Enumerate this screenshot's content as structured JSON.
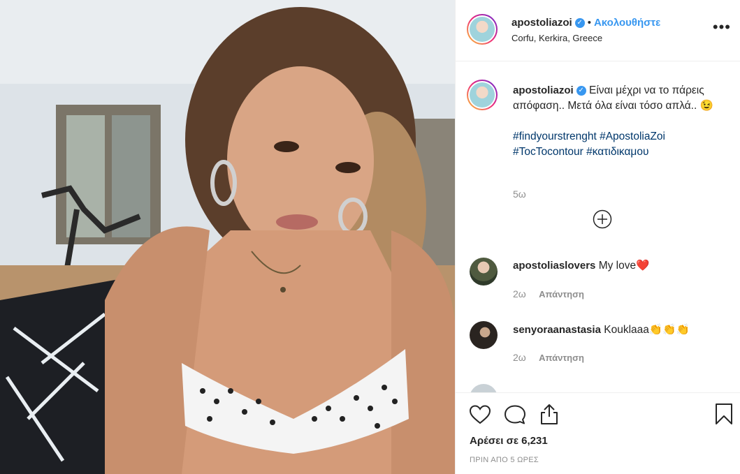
{
  "post": {
    "author": "apostoliazoi",
    "follow_label": "Ακολουθήστε",
    "separator": "•",
    "location": "Corfu, Kerkira, Greece"
  },
  "caption": {
    "username": "apostoliazoi",
    "text": "Είναι μέχρι να το πάρεις απόφαση.. Μετά όλα είναι τόσο απλά..",
    "emoji": "😉",
    "hashtags_line1": "#findyourstrenght #ApostoliaZoi",
    "hashtags_line2": "#TocTocontour #κατιδικαμου",
    "time": "5ω"
  },
  "comments": [
    {
      "username": "apostoliaslovers",
      "text": "My love",
      "emoji": "❤️",
      "time": "2ω",
      "reply_label": "Απάντηση"
    },
    {
      "username": "senyoraanastasia",
      "text": "Kouklaaa",
      "emoji": "👏👏👏",
      "time": "2ω",
      "reply_label": "Απάντηση"
    }
  ],
  "footer": {
    "likes_label": "Αρέσει σε 6,231",
    "timestamp": "ΠΡΙΝ ΑΠΟ 5 ΩΡΕΣ"
  },
  "icons": {
    "more": "more-options-icon",
    "load_more": "plus-circle-icon",
    "like": "heart-icon",
    "comment": "comment-icon",
    "share": "share-icon",
    "save": "bookmark-icon"
  },
  "colors": {
    "accent": "#3897f0",
    "text": "#262626",
    "muted": "#8e8e8e",
    "heart": "#ed4956"
  }
}
